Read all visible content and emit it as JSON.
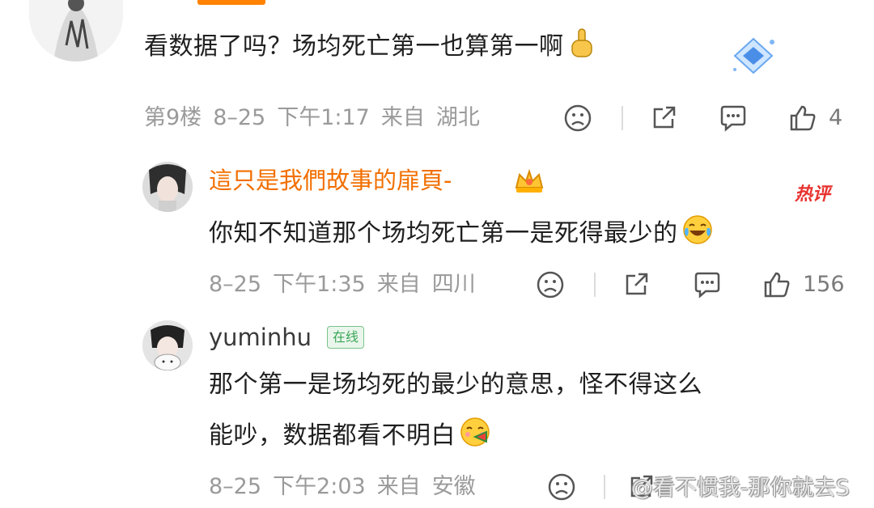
{
  "comment_1": {
    "text": "看数据了吗？场均死亡第一也算第一啊",
    "floor": "第9楼",
    "date": "8–25",
    "time": "下午1:17",
    "source": "来自",
    "location": "湖北",
    "likes": "4"
  },
  "reply_1": {
    "username": "這只是我們故事的扉頁-",
    "hot_badge": "热评",
    "text": "你知不知道那个场均死亡第一是死得最少的",
    "date": "8–25",
    "time": "下午1:35",
    "source": "来自",
    "location": "四川",
    "likes": "156"
  },
  "reply_2": {
    "username": "yuminhu",
    "status": "在线",
    "text_line1": "那个第一是场均死的最少的意思，怪不得这么",
    "text_line2": "能吵，数据都看不明白",
    "date": "8–25",
    "time": "下午2:03",
    "source": "来自",
    "location": "安徽"
  },
  "watermark": "@看不惯我-那你就去S",
  "icons": [
    "dislike-icon",
    "share-icon",
    "comment-icon",
    "like-icon",
    "pointing-up-emoji",
    "laugh-cry-emoji",
    "yum-emoji",
    "crown-badge-icon",
    "diamond-badge-icon"
  ],
  "colors": {
    "accent": "#ff8200",
    "username_highlight": "#f26f00",
    "meta": "#9a9a9a",
    "online": "#3aa757",
    "hot": "#e8322f"
  }
}
